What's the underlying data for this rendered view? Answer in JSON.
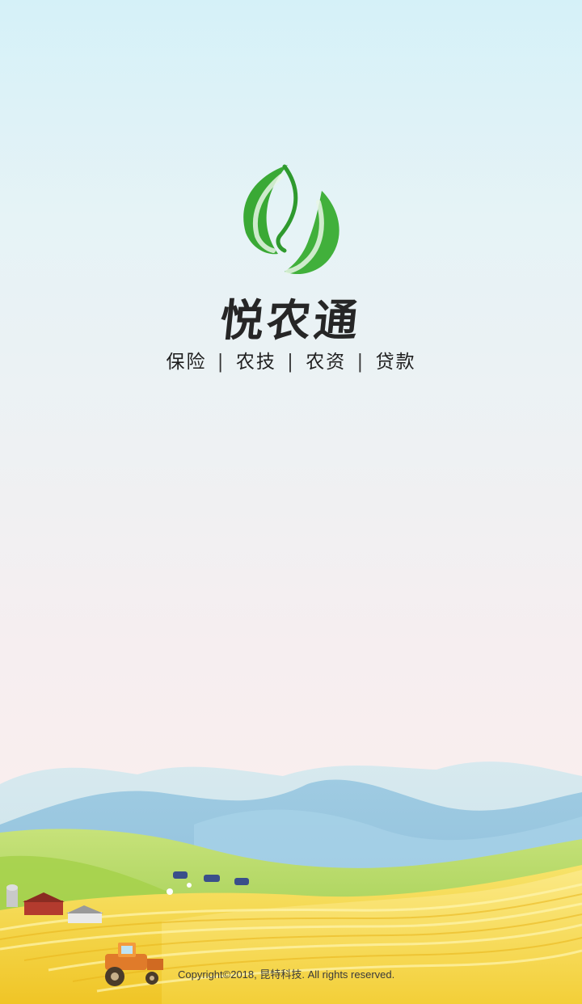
{
  "app": {
    "name": "悦农通",
    "services": [
      "保险",
      "农技",
      "农资",
      "贷款"
    ],
    "separator": "|",
    "copyright": "Copyright©2018, 昆特科技. All rights reserved."
  },
  "icons": {
    "logo": "leaf-logo-icon",
    "tractor": "tractor-icon",
    "cows": "cow-icon",
    "barn": "barn-icon",
    "silo": "silo-icon"
  },
  "colors": {
    "leaf_green": "#3aa935",
    "field_yellow": "#f4d23a",
    "field_green": "#9ccf4a",
    "mountain_blue": "#8fc3df"
  }
}
